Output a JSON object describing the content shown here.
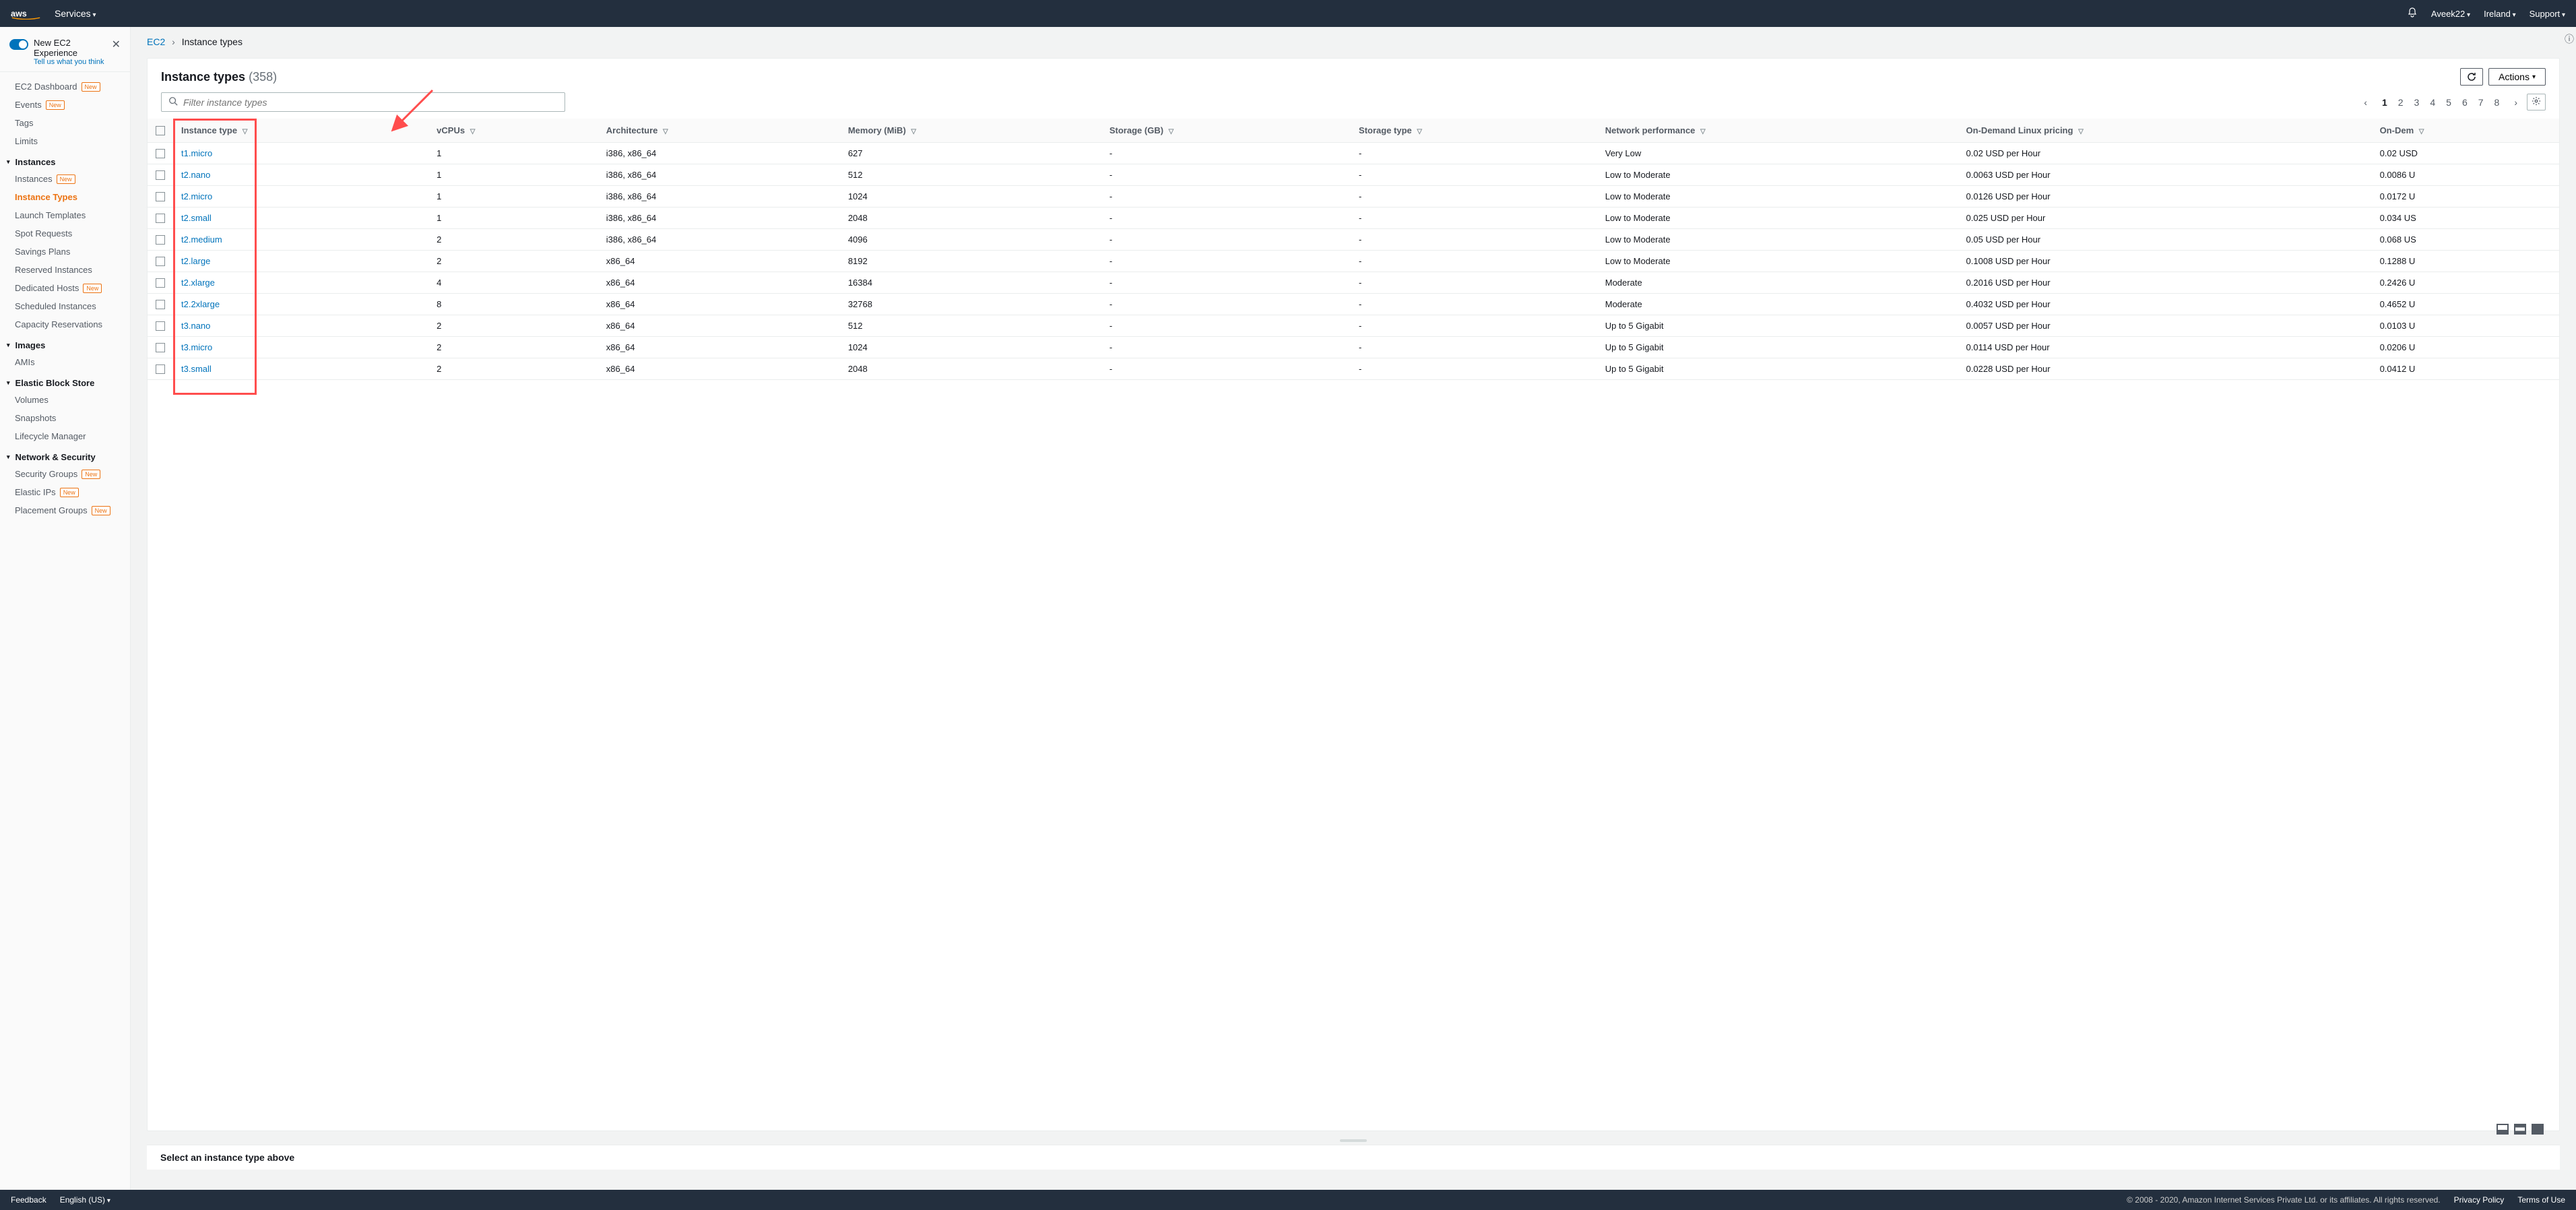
{
  "topnav": {
    "services": "Services",
    "user": "Aveek22",
    "region": "Ireland",
    "support": "Support"
  },
  "sidebar": {
    "banner_title": "New EC2 Experience",
    "banner_sub": "Tell us what you think",
    "items_top": [
      {
        "label": "EC2 Dashboard",
        "new": true
      },
      {
        "label": "Events",
        "new": true
      },
      {
        "label": "Tags",
        "new": false
      },
      {
        "label": "Limits",
        "new": false
      }
    ],
    "groups": [
      {
        "head": "Instances",
        "items": [
          {
            "label": "Instances",
            "new": true
          },
          {
            "label": "Instance Types",
            "new": false,
            "active": true
          },
          {
            "label": "Launch Templates",
            "new": false
          },
          {
            "label": "Spot Requests",
            "new": false
          },
          {
            "label": "Savings Plans",
            "new": false
          },
          {
            "label": "Reserved Instances",
            "new": false
          },
          {
            "label": "Dedicated Hosts",
            "new": true
          },
          {
            "label": "Scheduled Instances",
            "new": false
          },
          {
            "label": "Capacity Reservations",
            "new": false
          }
        ]
      },
      {
        "head": "Images",
        "items": [
          {
            "label": "AMIs",
            "new": false
          }
        ]
      },
      {
        "head": "Elastic Block Store",
        "items": [
          {
            "label": "Volumes",
            "new": false
          },
          {
            "label": "Snapshots",
            "new": false
          },
          {
            "label": "Lifecycle Manager",
            "new": false
          }
        ]
      },
      {
        "head": "Network & Security",
        "items": [
          {
            "label": "Security Groups",
            "new": true
          },
          {
            "label": "Elastic IPs",
            "new": true
          },
          {
            "label": "Placement Groups",
            "new": true
          }
        ]
      }
    ]
  },
  "breadcrumb": {
    "root": "EC2",
    "page": "Instance types"
  },
  "panel": {
    "title": "Instance types",
    "count": "(358)",
    "actions_label": "Actions",
    "filter_placeholder": "Filter instance types",
    "pager": {
      "pages": [
        "1",
        "2",
        "3",
        "4",
        "5",
        "6",
        "7",
        "8"
      ],
      "current": "1"
    }
  },
  "table": {
    "headers": [
      "Instance type",
      "vCPUs",
      "Architecture",
      "Memory (MiB)",
      "Storage (GB)",
      "Storage type",
      "Network performance",
      "On-Demand Linux pricing",
      "On-Dem"
    ],
    "rows": [
      {
        "name": "t1.micro",
        "vcpus": "1",
        "arch": "i386, x86_64",
        "mem": "627",
        "storage": "-",
        "stype": "-",
        "net": "Very Low",
        "linux": "0.02 USD per Hour",
        "win": "0.02 USD"
      },
      {
        "name": "t2.nano",
        "vcpus": "1",
        "arch": "i386, x86_64",
        "mem": "512",
        "storage": "-",
        "stype": "-",
        "net": "Low to Moderate",
        "linux": "0.0063 USD per Hour",
        "win": "0.0086 U"
      },
      {
        "name": "t2.micro",
        "vcpus": "1",
        "arch": "i386, x86_64",
        "mem": "1024",
        "storage": "-",
        "stype": "-",
        "net": "Low to Moderate",
        "linux": "0.0126 USD per Hour",
        "win": "0.0172 U"
      },
      {
        "name": "t2.small",
        "vcpus": "1",
        "arch": "i386, x86_64",
        "mem": "2048",
        "storage": "-",
        "stype": "-",
        "net": "Low to Moderate",
        "linux": "0.025 USD per Hour",
        "win": "0.034 US"
      },
      {
        "name": "t2.medium",
        "vcpus": "2",
        "arch": "i386, x86_64",
        "mem": "4096",
        "storage": "-",
        "stype": "-",
        "net": "Low to Moderate",
        "linux": "0.05 USD per Hour",
        "win": "0.068 US"
      },
      {
        "name": "t2.large",
        "vcpus": "2",
        "arch": "x86_64",
        "mem": "8192",
        "storage": "-",
        "stype": "-",
        "net": "Low to Moderate",
        "linux": "0.1008 USD per Hour",
        "win": "0.1288 U"
      },
      {
        "name": "t2.xlarge",
        "vcpus": "4",
        "arch": "x86_64",
        "mem": "16384",
        "storage": "-",
        "stype": "-",
        "net": "Moderate",
        "linux": "0.2016 USD per Hour",
        "win": "0.2426 U"
      },
      {
        "name": "t2.2xlarge",
        "vcpus": "8",
        "arch": "x86_64",
        "mem": "32768",
        "storage": "-",
        "stype": "-",
        "net": "Moderate",
        "linux": "0.4032 USD per Hour",
        "win": "0.4652 U"
      },
      {
        "name": "t3.nano",
        "vcpus": "2",
        "arch": "x86_64",
        "mem": "512",
        "storage": "-",
        "stype": "-",
        "net": "Up to 5 Gigabit",
        "linux": "0.0057 USD per Hour",
        "win": "0.0103 U"
      },
      {
        "name": "t3.micro",
        "vcpus": "2",
        "arch": "x86_64",
        "mem": "1024",
        "storage": "-",
        "stype": "-",
        "net": "Up to 5 Gigabit",
        "linux": "0.0114 USD per Hour",
        "win": "0.0206 U"
      },
      {
        "name": "t3.small",
        "vcpus": "2",
        "arch": "x86_64",
        "mem": "2048",
        "storage": "-",
        "stype": "-",
        "net": "Up to 5 Gigabit",
        "linux": "0.0228 USD per Hour",
        "win": "0.0412 U"
      }
    ]
  },
  "detail": {
    "msg": "Select an instance type above"
  },
  "footer": {
    "feedback": "Feedback",
    "lang": "English (US)",
    "copyright": "© 2008 - 2020, Amazon Internet Services Private Ltd. or its affiliates. All rights reserved.",
    "privacy": "Privacy Policy",
    "terms": "Terms of Use"
  }
}
